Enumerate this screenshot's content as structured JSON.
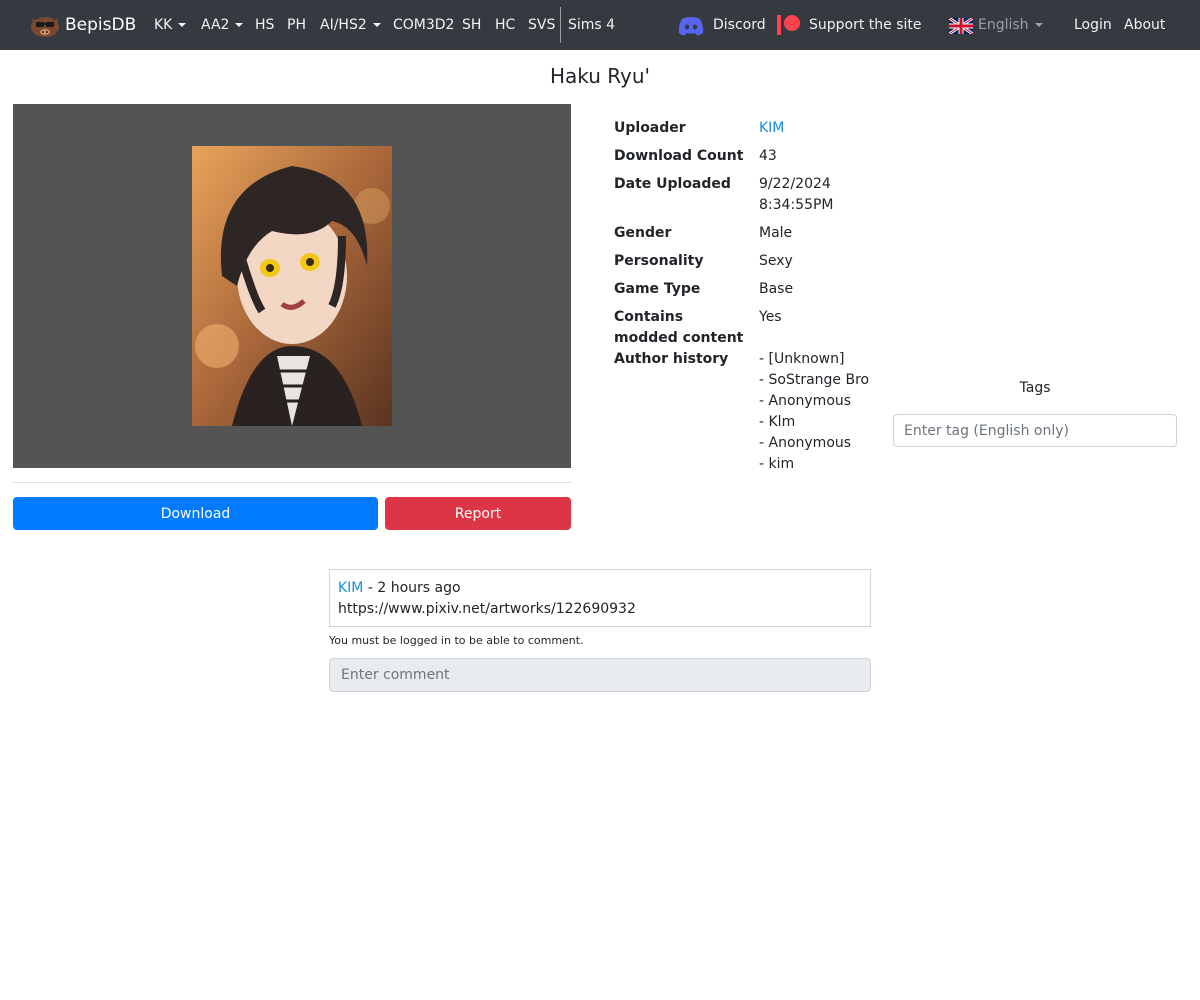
{
  "navbar": {
    "brand": "BepisDB",
    "items": [
      {
        "label": "KK",
        "dropdown": true
      },
      {
        "label": "AA2",
        "dropdown": true
      },
      {
        "label": "HS",
        "dropdown": false
      },
      {
        "label": "PH",
        "dropdown": false
      },
      {
        "label": "AI/HS2",
        "dropdown": true
      },
      {
        "label": "COM3D2",
        "dropdown": false
      },
      {
        "label": "SH",
        "dropdown": false
      },
      {
        "label": "HC",
        "dropdown": false
      },
      {
        "label": "SVS",
        "dropdown": false
      },
      {
        "label": "Sims 4",
        "dropdown": false
      }
    ],
    "discord": "Discord",
    "support": "Support the site",
    "language": "English",
    "login": "Login",
    "about": "About",
    "colors": {
      "background": "#343a40",
      "discord": "#5865f2",
      "patreon": "#ff424d"
    }
  },
  "card": {
    "title": "Haku Ryu'"
  },
  "actions": {
    "download": "Download",
    "report": "Report",
    "colors": {
      "download": "#007bff",
      "report": "#dc3545"
    }
  },
  "info": {
    "uploader_label": "Uploader",
    "uploader_value": "KIM",
    "download_count_label": "Download Count",
    "download_count_value": "43",
    "date_label": "Date Uploaded",
    "date_value_line1": "9/22/2024",
    "date_value_line2": "8:34:55PM",
    "gender_label": "Gender",
    "gender_value": "Male",
    "personality_label": "Personality",
    "personality_value": "Sexy",
    "game_type_label": "Game Type",
    "game_type_value": "Base",
    "modded_label_line1": "Contains",
    "modded_label_line2": "modded content",
    "modded_value": "Yes",
    "author_history_label": "Author history",
    "author_history": [
      "- [Unknown]",
      "- SoStrange Bro",
      "- Anonymous",
      "- Klm",
      "- Anonymous",
      "- kim"
    ]
  },
  "tags": {
    "title": "Tags",
    "placeholder": "Enter tag (English only)"
  },
  "comments": {
    "items": [
      {
        "author": "KIM",
        "time": " - 2 hours ago",
        "text": "https://www.pixiv.net/artworks/122690932"
      }
    ],
    "login_note": "You must be logged in to be able to comment.",
    "placeholder": "Enter comment"
  }
}
